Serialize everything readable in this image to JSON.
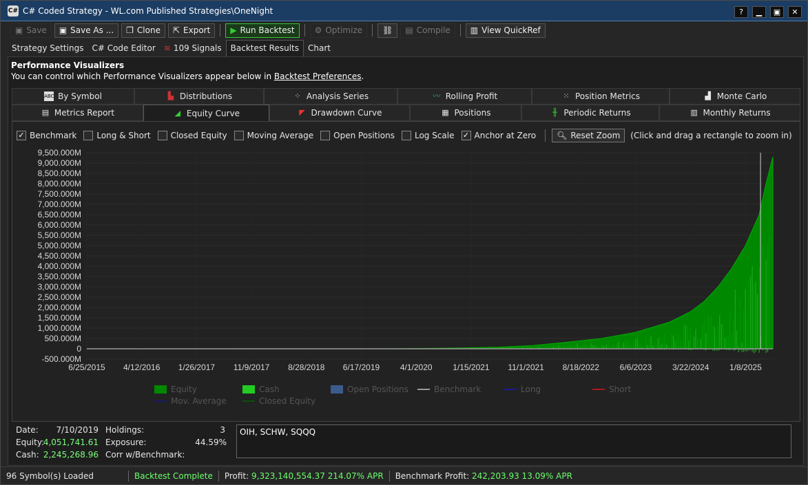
{
  "window": {
    "title": "C# Coded Strategy - WL.com Published Strategies\\OneNight",
    "app_icon": "C#"
  },
  "toolbar": {
    "save": "Save",
    "save_as": "Save As ...",
    "clone": "Clone",
    "export": "Export",
    "run_backtest": "Run Backtest",
    "optimize": "Optimize",
    "compile": "Compile",
    "view_quickref": "View QuickRef"
  },
  "tabs": [
    "Strategy Settings",
    "C# Code Editor",
    "109 Signals",
    "Backtest Results",
    "Chart"
  ],
  "perf": {
    "heading": "Performance Visualizers",
    "sub_prefix": "You can control which Performance Visualizers appear below in ",
    "sub_link": "Backtest Preferences",
    "sub_suffix": "."
  },
  "vis_row1": [
    "By Symbol",
    "Distributions",
    "Analysis Series",
    "Rolling Profit",
    "Position Metrics",
    "Monte Carlo"
  ],
  "vis_row2": [
    "Metrics Report",
    "Equity Curve",
    "Drawdown Curve",
    "Positions",
    "Periodic Returns",
    "Monthly Returns"
  ],
  "options": {
    "benchmark": "Benchmark",
    "long_short": "Long & Short",
    "closed_equity": "Closed Equity",
    "moving_average": "Moving Average",
    "open_positions": "Open Positions",
    "log_scale": "Log Scale",
    "anchor_zero": "Anchor at Zero",
    "reset_zoom": "Reset Zoom",
    "hint": "(Click and drag a rectangle to zoom in)",
    "checked": {
      "benchmark": true,
      "long_short": false,
      "closed_equity": false,
      "moving_average": false,
      "open_positions": false,
      "log_scale": false,
      "anchor_zero": true
    }
  },
  "chart_data": {
    "type": "area",
    "ylim": [
      -500,
      9500
    ],
    "y_unit": "M",
    "y_ticks": [
      "9,500.000M",
      "9,000.000M",
      "8,500.000M",
      "8,000.000M",
      "7,500.000M",
      "7,000.000M",
      "6,500.000M",
      "6,000.000M",
      "5,500.000M",
      "5,000.000M",
      "4,500.000M",
      "4,000.000M",
      "3,500.000M",
      "3,000.000M",
      "2,500.000M",
      "2,000.000M",
      "1,500.000M",
      "1,000.000M",
      "500.000M",
      "0",
      "-500.000M"
    ],
    "x_ticks": [
      "6/25/2015",
      "4/12/2016",
      "1/26/2017",
      "11/9/2017",
      "8/28/2018",
      "6/17/2019",
      "4/1/2020",
      "1/15/2021",
      "11/1/2021",
      "8/18/2022",
      "6/6/2023",
      "3/22/2024",
      "1/8/2025"
    ],
    "x_range": [
      "6/25/2015",
      "7/1/2025"
    ],
    "series": [
      {
        "name": "Equity",
        "color": "#008800",
        "x": [
          0,
          0.44,
          0.5,
          0.55,
          0.6,
          0.65,
          0.7,
          0.75,
          0.8,
          0.85,
          0.88,
          0.9,
          0.92,
          0.94,
          0.96,
          0.98,
          0.99,
          1.0
        ],
        "values": [
          0,
          4,
          20,
          40,
          80,
          160,
          320,
          500,
          800,
          1300,
          1800,
          2300,
          3000,
          3900,
          5000,
          6500,
          8000,
          9300
        ]
      },
      {
        "name": "Cash",
        "color": "#33cc33"
      },
      {
        "name": "Open Positions",
        "color": "#3b5b8c"
      },
      {
        "name": "Benchmark",
        "color": "#9a9a9a"
      },
      {
        "name": "Long",
        "color": "#1a1a99"
      },
      {
        "name": "Short",
        "color": "#aa1a1a"
      },
      {
        "name": "Mov. Average",
        "color": "#1a1a66"
      },
      {
        "name": "Closed Equity",
        "color": "#0e4d0e"
      }
    ],
    "grid": true,
    "legend": "bottom"
  },
  "stats": {
    "date_label": "Date:",
    "date": "7/10/2019",
    "equity_label": "Equity:",
    "equity": "4,051,741.61",
    "cash_label": "Cash:",
    "cash": "2,245,268.96",
    "holdings_label": "Holdings:",
    "holdings": "3",
    "exposure_label": "Exposure:",
    "exposure": "44.59%",
    "corr_label": "Corr w/Benchmark:",
    "symbols": "OIH, SCHW, SQQQ"
  },
  "status": {
    "loaded": "96 Symbol(s) Loaded",
    "complete": "Backtest Complete",
    "profit_label": "Profit:",
    "profit": "9,323,140,554.37 214.07% APR",
    "bench_label": "Benchmark Profit:",
    "bench": "242,203.93 13.09% APR"
  }
}
